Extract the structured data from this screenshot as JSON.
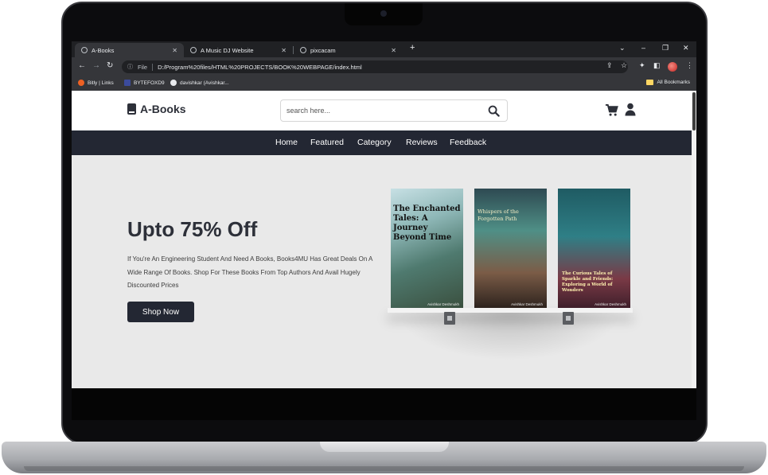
{
  "browser": {
    "tabs": [
      {
        "title": "A-Books",
        "active": true
      },
      {
        "title": "A Music DJ Website",
        "active": false
      },
      {
        "title": "pixcacam",
        "active": false
      }
    ],
    "new_tab_label": "+",
    "address": {
      "info_label": "File",
      "url": "D:/Program%20files/HTML%20PROJECTS/BOOK%20WEBPAGE/index.html"
    },
    "bookmarks": [
      {
        "label": "Bitly | Links",
        "color": "#ee6123"
      },
      {
        "label": "BYTEFOXD9",
        "color": "#3b4b9c"
      },
      {
        "label": "davishkar (Avishkar...",
        "color": "#e8eaed"
      }
    ],
    "all_bookmarks_label": "All Bookmarks"
  },
  "site": {
    "logo": "A-Books",
    "search_placeholder": "search here...",
    "nav": [
      "Home",
      "Featured",
      "Category",
      "Reviews",
      "Feedback"
    ],
    "hero": {
      "title": "Upto 75% Off",
      "description": "If You're An Engineering Student And Need A Books, Books4MU Has Great Deals On A Wide Range Of Books. Shop For These Books From Top Authors And Avail Hugely Discounted Prices",
      "cta": "Shop Now"
    },
    "books": [
      {
        "title": "The Enchanted Tales: A Journey Beyond Time",
        "author": "Avishkar Deshmukh"
      },
      {
        "title": "Whispers of the Forgotten Path",
        "author": "Avishkar Deshmukh"
      },
      {
        "title": "The Curious Tales of Sparkle and Friends: Exploring a World of Wonders",
        "author": "Avishkar Deshmukh"
      }
    ]
  },
  "colors": {
    "accent": "#232733",
    "nav_bg": "#232733",
    "hero_bg": "#e9e9e9"
  }
}
